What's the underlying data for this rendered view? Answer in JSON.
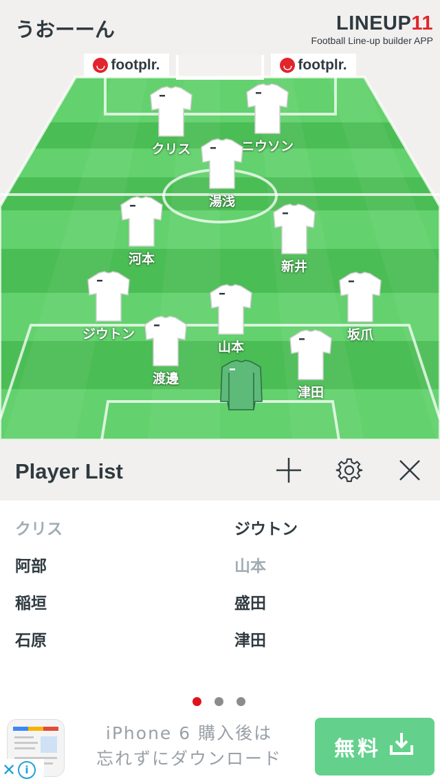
{
  "header": {
    "team_name": "うおーーん",
    "brand_main": "LINEUP",
    "brand_num": "11",
    "brand_sub": "Football Line-up builder APP"
  },
  "sponsors": [
    {
      "label": "footplr."
    },
    {
      "label": "footplr."
    }
  ],
  "pitch": {
    "players": [
      {
        "name": "クリス",
        "kit": "white"
      },
      {
        "name": "ニウソン",
        "kit": "white"
      },
      {
        "name": "湯浅",
        "kit": "white"
      },
      {
        "name": "河本",
        "kit": "white"
      },
      {
        "name": "新井",
        "kit": "white"
      },
      {
        "name": "ジウトン",
        "kit": "white"
      },
      {
        "name": "山本",
        "kit": "white"
      },
      {
        "name": "坂爪",
        "kit": "white"
      },
      {
        "name": "渡邊",
        "kit": "white"
      },
      {
        "name": "津田",
        "kit": "white"
      },
      {
        "name": "",
        "kit": "goalkeeper"
      }
    ],
    "colors": {
      "grass_light": "#63d16d",
      "grass_dark": "#4bbd55",
      "lines": "#ffffff",
      "gk_kit": "#5dba78"
    }
  },
  "panel": {
    "title": "Player List",
    "add_icon": "plus-icon",
    "settings_icon": "gear-icon",
    "close_icon": "close-icon"
  },
  "player_list": {
    "left": [
      {
        "name": "クリス",
        "placed": true
      },
      {
        "name": "阿部",
        "placed": false
      },
      {
        "name": "稲垣",
        "placed": false
      },
      {
        "name": "石原",
        "placed": false
      }
    ],
    "right": [
      {
        "name": "ジウトン",
        "placed": false
      },
      {
        "name": "山本",
        "placed": true
      },
      {
        "name": "盛田",
        "placed": false
      },
      {
        "name": "津田",
        "placed": false
      }
    ]
  },
  "pager": {
    "pages": 3,
    "active": 1
  },
  "ad": {
    "line1": "iPhone 6 購入後は",
    "line2": "忘れずにダウンロード",
    "button": "無料",
    "accent": "#63d18c"
  }
}
